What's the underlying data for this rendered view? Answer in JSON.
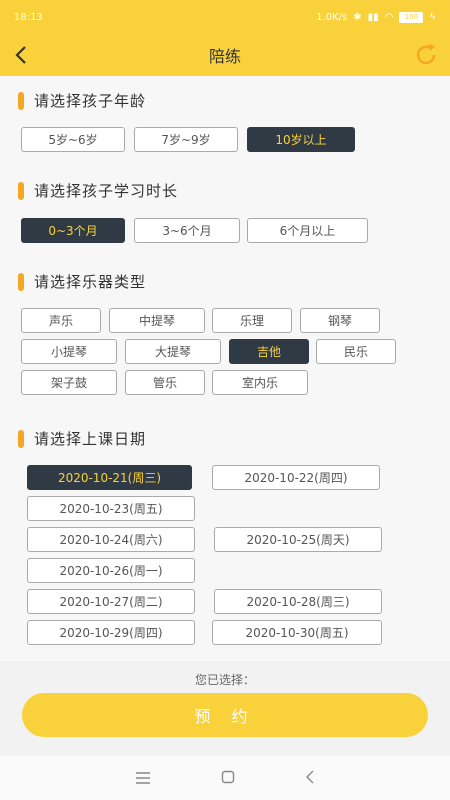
{
  "status": {
    "time": "18:13",
    "speed": "1.0K/s",
    "battery": "100"
  },
  "header": {
    "title": "陪练"
  },
  "sections": [
    {
      "title": "请选择孩子年龄"
    },
    {
      "title": "请选择孩子学习时长"
    },
    {
      "title": "请选择乐器类型"
    },
    {
      "title": "请选择上课日期"
    }
  ],
  "age_options": [
    "5岁~6岁",
    "7岁~9岁",
    "10岁以上"
  ],
  "duration_options": [
    "0~3个月",
    "3~6个月",
    "6个月以上"
  ],
  "instrument_options": [
    "声乐",
    "中提琴",
    "乐理",
    "钢琴",
    "小提琴",
    "大提琴",
    "吉他",
    "民乐",
    "架子鼓",
    "管乐",
    "室内乐"
  ],
  "date_options": [
    "2020-10-21(周三)",
    "2020-10-22(周四)",
    "2020-10-23(周五)",
    "2020-10-24(周六)",
    "2020-10-25(周天)",
    "2020-10-26(周一)",
    "2020-10-27(周二)",
    "2020-10-28(周三)",
    "2020-10-29(周四)",
    "2020-10-30(周五)"
  ],
  "selected": {
    "age": "10岁以上",
    "duration": "0~3个月",
    "instrument": "吉他",
    "date": "2020-10-21(周三)"
  },
  "footer": {
    "selected_label": "您已选择：",
    "book_label": "预 约"
  },
  "colors": {
    "accent": "#f9d23b",
    "selected_bg": "#2f3a44",
    "marker": "#f5a623"
  }
}
